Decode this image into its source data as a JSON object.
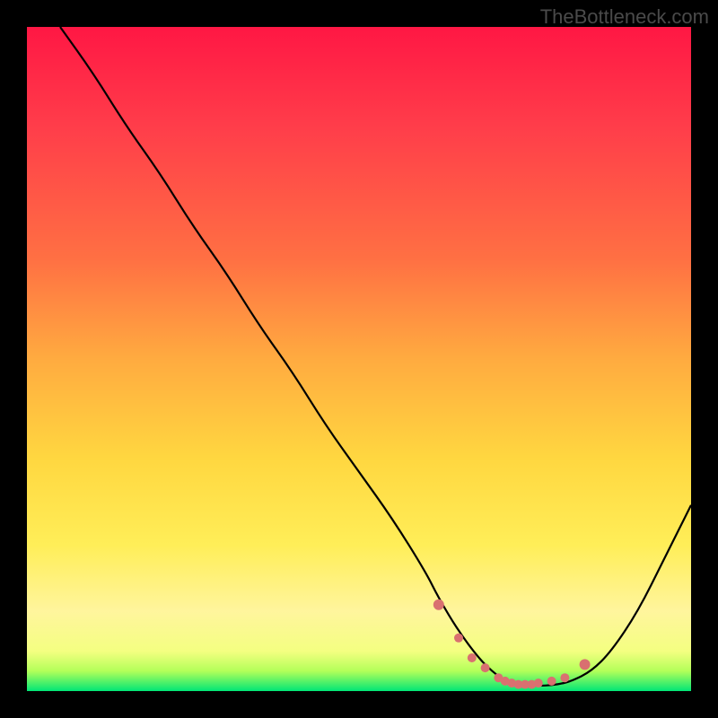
{
  "watermark": "TheBottleneck.com",
  "chart_data": {
    "type": "line",
    "title": "",
    "xlabel": "",
    "ylabel": "",
    "xlim": [
      0,
      100
    ],
    "ylim": [
      0,
      100
    ],
    "series": [
      {
        "name": "bottleneck-curve",
        "x": [
          5,
          10,
          15,
          20,
          25,
          30,
          35,
          40,
          45,
          50,
          55,
          60,
          62,
          65,
          68,
          70,
          72,
          74,
          76,
          78,
          80,
          82,
          85,
          88,
          92,
          96,
          100
        ],
        "y": [
          100,
          93,
          85,
          78,
          70,
          63,
          55,
          48,
          40,
          33,
          26,
          18,
          14,
          9,
          5,
          3,
          1.5,
          1,
          0.8,
          0.8,
          1,
          1.5,
          3,
          6,
          12,
          20,
          28
        ]
      }
    ],
    "markers": {
      "name": "highlighted-points",
      "color": "#d97070",
      "x": [
        62,
        65,
        67,
        69,
        71,
        72,
        73,
        74,
        75,
        76,
        77,
        79,
        81,
        84
      ],
      "y": [
        13,
        8,
        5,
        3.5,
        2,
        1.5,
        1.2,
        1,
        1,
        1,
        1.2,
        1.5,
        2,
        4
      ]
    },
    "gradient_stops": [
      {
        "offset": 0,
        "color": "#ff1744"
      },
      {
        "offset": 0.15,
        "color": "#ff3d4a"
      },
      {
        "offset": 0.35,
        "color": "#ff7043"
      },
      {
        "offset": 0.5,
        "color": "#ffab40"
      },
      {
        "offset": 0.65,
        "color": "#ffd740"
      },
      {
        "offset": 0.78,
        "color": "#ffee58"
      },
      {
        "offset": 0.88,
        "color": "#fff59d"
      },
      {
        "offset": 0.94,
        "color": "#f4ff81"
      },
      {
        "offset": 0.97,
        "color": "#b2ff59"
      },
      {
        "offset": 1,
        "color": "#00e676"
      }
    ]
  }
}
